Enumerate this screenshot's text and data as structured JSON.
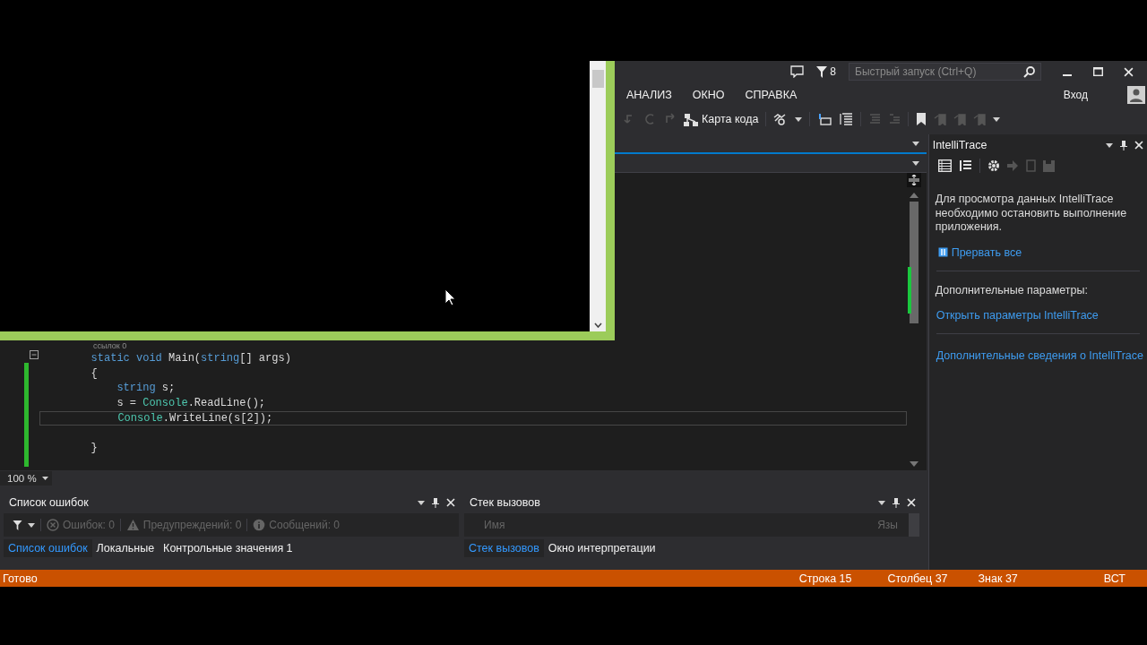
{
  "title_bar": {
    "notifications_count": "8",
    "quick_launch": {
      "placeholder": "Быстрый запуск (Ctrl+Q)"
    }
  },
  "menu": [
    "АНАЛИЗ",
    "ОКНО",
    "СПРАВКА"
  ],
  "account": {
    "label": "Вход"
  },
  "toolbar": {
    "code_map": "Карта кода"
  },
  "editor": {
    "codelens": "ссылок 0",
    "lines": [
      {
        "kind": "code",
        "current": false,
        "tokens": [
          {
            "text": "        static void ",
            "kind": "keyword"
          },
          {
            "text": "Main(",
            "kind": "plain"
          },
          {
            "text": "string",
            "kind": "keyword"
          },
          {
            "text": "[] args)",
            "kind": "plain"
          }
        ]
      },
      {
        "kind": "code",
        "current": false,
        "tokens": [
          {
            "text": "        {",
            "kind": "plain"
          }
        ]
      },
      {
        "kind": "code",
        "current": false,
        "tokens": [
          {
            "text": "            string",
            "kind": "keyword"
          },
          {
            "text": " s;",
            "kind": "plain"
          }
        ]
      },
      {
        "kind": "code",
        "current": false,
        "tokens": [
          {
            "text": "            s = ",
            "kind": "plain"
          },
          {
            "text": "Console",
            "kind": "type"
          },
          {
            "text": ".ReadLine();",
            "kind": "plain"
          }
        ]
      },
      {
        "kind": "code",
        "current": true,
        "tokens": [
          {
            "text": "            Console",
            "kind": "type"
          },
          {
            "text": ".WriteLine(s[2]);",
            "kind": "plain"
          }
        ]
      },
      {
        "kind": "blank",
        "current": false
      },
      {
        "kind": "code",
        "current": false,
        "tokens": [
          {
            "text": "        }",
            "kind": "plain"
          }
        ]
      }
    ],
    "zoom": "100 %"
  },
  "error_list": {
    "title": "Список ошибок",
    "filters": [
      {
        "kind": "error",
        "label": "Ошибок: 0",
        "disabled": true
      },
      {
        "kind": "warning",
        "label": "Предупреждений: 0",
        "disabled": true
      },
      {
        "kind": "message",
        "label": "Сообщений: 0",
        "disabled": true
      }
    ],
    "tabs": [
      {
        "label": "Список ошибок",
        "selected": true
      },
      {
        "label": "Локальные",
        "selected": false
      },
      {
        "label": "Контрольные значения 1",
        "selected": false
      }
    ]
  },
  "call_stack": {
    "title": "Стек вызовов",
    "columns": [
      "Имя",
      "Язы"
    ],
    "tabs": [
      {
        "label": "Стек вызовов",
        "selected": true
      },
      {
        "label": "Окно интерпретации",
        "selected": false
      }
    ]
  },
  "intellitrace": {
    "title": "IntelliTrace",
    "message": "Для просмотра данных IntelliTrace необходимо остановить выполнение приложения.",
    "break_all": "Прервать все",
    "options_heading": "Дополнительные параметры:",
    "links": [
      "Открыть параметры IntelliTrace",
      "Дополнительные сведения о IntelliTrace"
    ]
  },
  "status_bar": {
    "state": "Готово",
    "line": "Строка 15",
    "column": "Столбец 37",
    "char": "Знак 37",
    "mode": "ВСТ"
  }
}
